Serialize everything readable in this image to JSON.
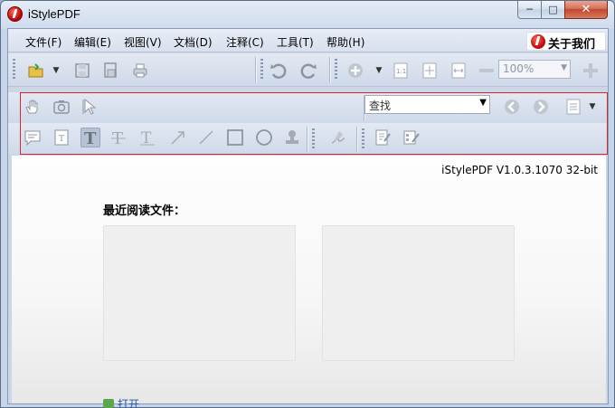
{
  "window": {
    "title": "iStylePDF",
    "controls": {
      "minimize": "─",
      "maximize": "□",
      "close": "✕"
    }
  },
  "menu": {
    "items": [
      "文件(F)",
      "编辑(E)",
      "视图(V)",
      "文档(D)",
      "注释(C)",
      "工具(T)",
      "帮助(H)"
    ],
    "about_label": "关于我们"
  },
  "toolbar": {
    "zoom_value": "100%",
    "search_placeholder": "查找"
  },
  "content": {
    "version": "iStylePDF V1.0.3.1070 32-bit",
    "recent_title": "最近阅读文件：",
    "open_label": "打开"
  },
  "colors": {
    "accent_red": "#d9262c",
    "frame_blue": "#ccd6e7",
    "icon_gray": "#8d95a3"
  }
}
